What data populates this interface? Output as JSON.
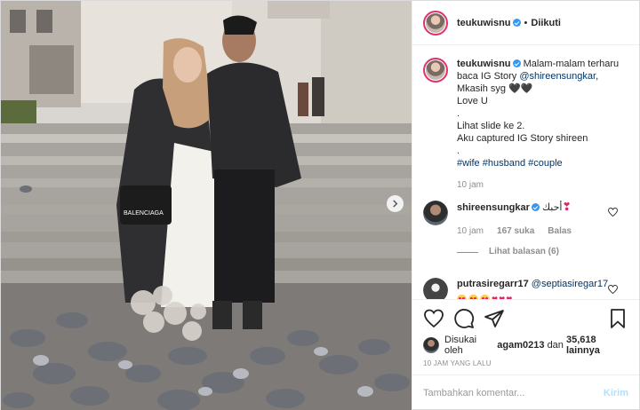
{
  "post": {
    "author": "teukuwisnu",
    "follow_state": "Diikuti",
    "separator": "•"
  },
  "caption": {
    "author": "teukuwisnu",
    "lines": [
      "Malam-malam terharu",
      "baca IG Story ",
      "Mkasih syg 🖤🖤",
      "Love U",
      ".",
      "Lihat slide ke 2.",
      "Aku captured IG Story shireen",
      "."
    ],
    "mention": "@shireensungkar",
    "hashtags": "#wife #husband #couple",
    "time": "10 jam"
  },
  "comments": [
    {
      "author": "shireensungkar",
      "text": "أحبك",
      "time": "10 jam",
      "likes": "167 suka",
      "reply_label": "Balas",
      "view_replies": "Lihat balasan (6)"
    },
    {
      "author": "putrasiregarr17",
      "mention": "@septiasiregar17",
      "emoji_count": 6
    }
  ],
  "likes": {
    "prefix": "Disukai oleh",
    "first_user": "agam0213",
    "connector": "dan",
    "others": "35,618 lainnya"
  },
  "date": "10 JAM YANG LALU",
  "composer": {
    "placeholder": "Tambahkan komentar...",
    "send_label": "Kirim"
  },
  "colors": {
    "link": "#003569",
    "verified": "#3897f0",
    "meta": "#8e8e8e",
    "send_disabled": "#b2dffc"
  },
  "icons": [
    "heart-icon",
    "comment-icon",
    "share-icon",
    "bookmark-icon",
    "verified-icon",
    "chevron-right-icon"
  ]
}
